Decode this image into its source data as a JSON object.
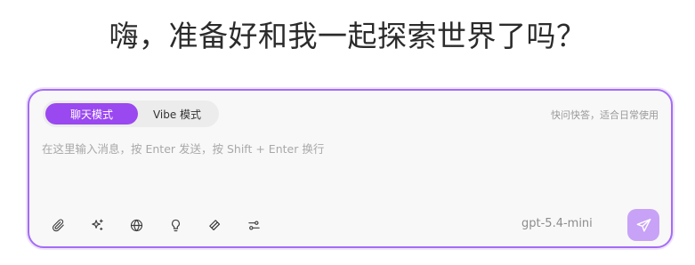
{
  "headline": "嗨，准备好和我一起探索世界了吗？",
  "composer": {
    "modes": [
      {
        "label": "聊天模式",
        "active": true
      },
      {
        "label": "Vibe 模式",
        "active": false
      }
    ],
    "mode_hint": "快问快答，适合日常使用",
    "input_placeholder": "在这里输入消息，按 Enter 发送，按 Shift + Enter 换行",
    "input_value": "",
    "tools": [
      {
        "name": "attach-icon"
      },
      {
        "name": "sparkles-icon"
      },
      {
        "name": "globe-icon"
      },
      {
        "name": "lightbulb-icon"
      },
      {
        "name": "layers-icon"
      },
      {
        "name": "sliders-icon"
      }
    ],
    "model": "gpt-5.4-mini",
    "send_icon": "send-icon"
  },
  "colors": {
    "accent": "#9a48f0",
    "border": "#a46cf5",
    "send_button": "#c8a2f7",
    "composer_bg": "#f8f8f8"
  }
}
